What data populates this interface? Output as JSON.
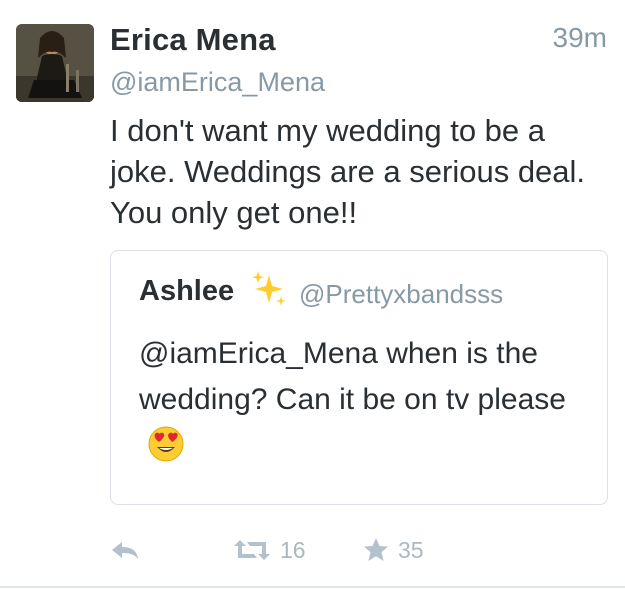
{
  "tweet": {
    "author_name": "Erica Mena",
    "author_handle": "@iamErica_Mena",
    "time": "39m",
    "text": "I don't want my wedding to be a joke. Weddings are a serious deal. You only get one!!"
  },
  "quoted": {
    "author_name": "Ashlee",
    "name_emoji": "sparkles",
    "author_handle": "@Prettyxbandsss",
    "text": "@iamErica_Mena when is the wedding? Can it be on tv please",
    "trailing_emoji": "heart-eyes"
  },
  "actions": {
    "reply_icon": "reply-icon",
    "retweet_icon": "retweet-icon",
    "retweet_count": "16",
    "favorite_icon": "star-icon",
    "favorite_count": "35"
  },
  "colors": {
    "primary_text": "#292f33",
    "secondary_text": "#8899a6",
    "action_gray": "#aab8c2",
    "quote_border": "#dbe1e6"
  }
}
